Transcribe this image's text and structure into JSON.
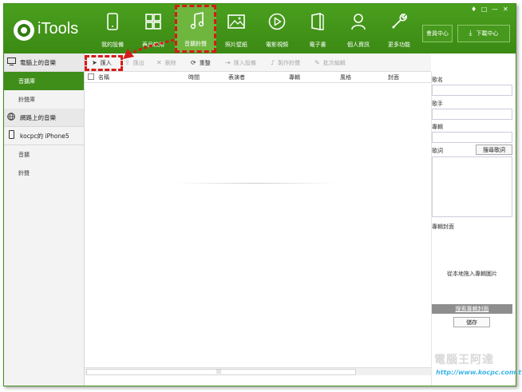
{
  "app": {
    "name": "iTools"
  },
  "window_controls": [
    "♦",
    "□",
    "—",
    "✕"
  ],
  "nav": [
    {
      "label": "我的設備",
      "icon": "phone-icon"
    },
    {
      "label": "再品軟用",
      "icon": "apps-icon"
    },
    {
      "label": "音擴鈴聲",
      "icon": "music-icon",
      "active": true
    },
    {
      "label": "照片壁紙",
      "icon": "photo-icon"
    },
    {
      "label": "電影視頻",
      "icon": "play-icon"
    },
    {
      "label": "電子書",
      "icon": "book-icon"
    },
    {
      "label": "個人資訊",
      "icon": "person-icon"
    },
    {
      "label": "更多功能",
      "icon": "wrench-icon"
    }
  ],
  "header_buttons": {
    "member": "會員中心",
    "download": "下載中心"
  },
  "sidebar": {
    "sections": [
      {
        "title": "電腦上的音樂",
        "icon": "monitor-icon",
        "items": [
          {
            "label": "音擴庫",
            "selected": true
          },
          {
            "label": "鈴聲庫"
          }
        ]
      },
      {
        "title": "網路上的音樂",
        "icon": "globe-icon",
        "items": []
      },
      {
        "title": "kocpc的 iPhone5",
        "icon": "iphone-icon",
        "items": [
          {
            "label": "音擴"
          },
          {
            "label": "鈴聲"
          }
        ]
      }
    ]
  },
  "toolbar": {
    "import": "匯入",
    "export": "匯出",
    "delete": "刪除",
    "refresh": "重整",
    "import_device": "匯入設備",
    "make_ringtone": "製作鈴聲",
    "batch_edit": "批次編輯"
  },
  "table": {
    "columns": [
      "名稱",
      "時間",
      "表演者",
      "專輯",
      "風格",
      "封面"
    ]
  },
  "details": {
    "song_name_label": "歌名",
    "artist_label": "歌手",
    "album_label": "專輯",
    "lyrics_label": "歌詞",
    "search_lyrics_button": "搜尋歌詞",
    "album_cover_label": "專輯封面",
    "drag_hint": "從本地拖入專輯圖片",
    "search_cover_button": "搜索專輯封面",
    "save_button": "儲存"
  },
  "watermark": {
    "brand": "電腦王阿達",
    "url": "http://www.kocpc.com.tw"
  },
  "colors": {
    "brand_green": "#3f8e1a",
    "highlight_red": "#d51b1b",
    "active_tab": "#6fb63f"
  }
}
